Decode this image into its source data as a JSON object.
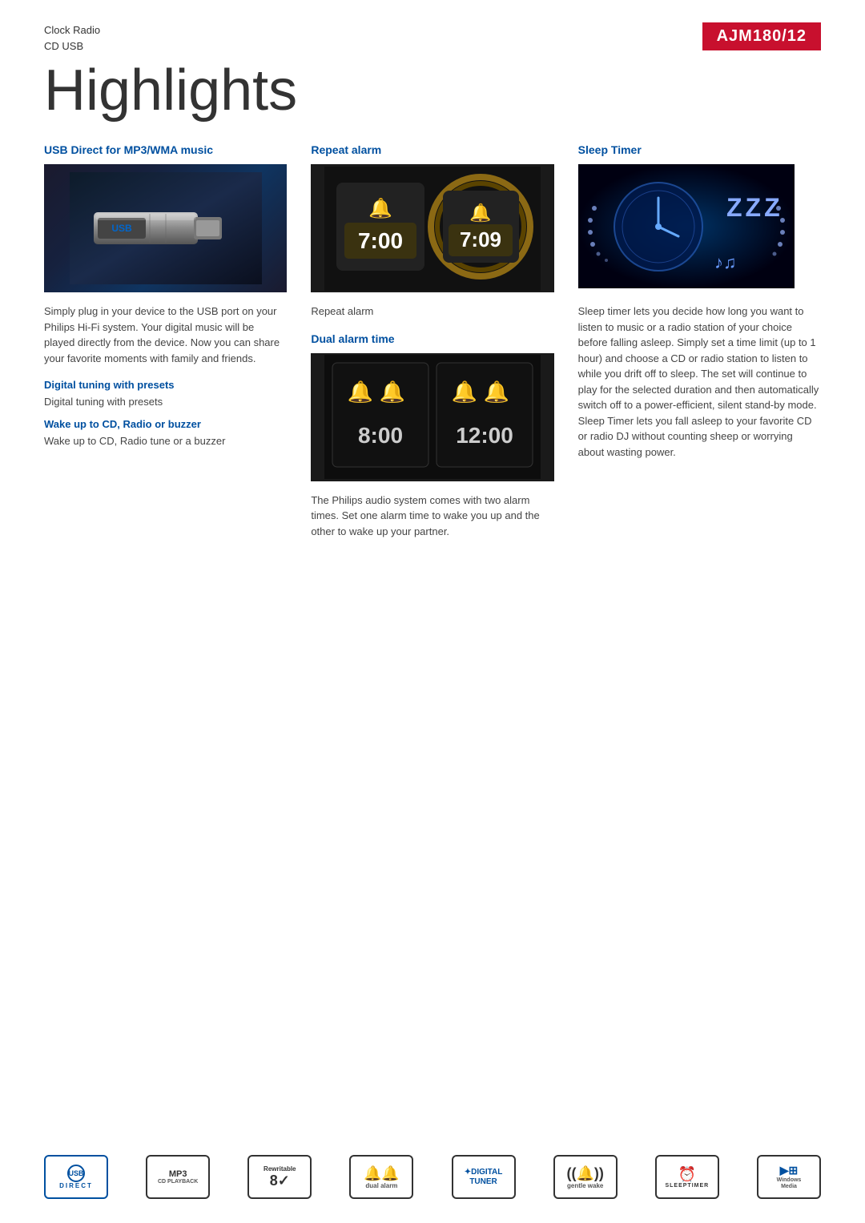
{
  "header": {
    "product_type": "Clock Radio",
    "product_subtype": "CD USB",
    "model": "AJM180/12"
  },
  "page": {
    "title": "Highlights"
  },
  "columns": [
    {
      "id": "col1",
      "sections": [
        {
          "id": "usb-direct",
          "title": "USB Direct for MP3/WMA music",
          "description": "Simply plug in your device to the USB port on your Philips Hi-Fi system. Your digital music will be played directly from the device. Now you can share your favorite moments with family and friends.",
          "image_alt": "USB drive image"
        },
        {
          "id": "digital-tuning",
          "title": "Digital tuning with presets",
          "description": "Digital tuning with presets"
        },
        {
          "id": "wake-up",
          "title": "Wake up to CD, Radio or buzzer",
          "description": "Wake up to CD, Radio tune or a buzzer"
        }
      ]
    },
    {
      "id": "col2",
      "sections": [
        {
          "id": "repeat-alarm",
          "title": "Repeat alarm",
          "image_alt": "Repeat alarm clock display",
          "description": "Repeat alarm",
          "time1": "7:00",
          "time2": "7:09"
        },
        {
          "id": "dual-alarm",
          "title": "Dual alarm time",
          "image_alt": "Dual alarm clock display",
          "description": "The Philips audio system comes with two alarm times. Set one alarm time to wake you up and the other to wake up your partner.",
          "time1": "8:00",
          "time2": "12:00"
        }
      ]
    },
    {
      "id": "col3",
      "sections": [
        {
          "id": "sleep-timer",
          "title": "Sleep Timer",
          "image_alt": "Sleep timer clock image",
          "description": "Sleep timer lets you decide how long you want to listen to music or a radio station of your choice before falling asleep. Simply set a time limit (up to 1 hour) and choose a CD or radio station to listen to while you drift off to sleep. The set will continue to play for the selected duration and then automatically switch off to a power-efficient, silent stand-by mode. Sleep Timer lets you fall asleep to your favorite CD or radio DJ without counting sheep or worrying about wasting power."
        }
      ]
    }
  ],
  "footer": {
    "badges": [
      {
        "id": "usb-direct-badge",
        "icon": "USB",
        "label": "DIRECT",
        "type": "usb"
      },
      {
        "id": "mp3-badge",
        "icon": "MP3",
        "label": "CD PLAYBACK",
        "type": "mp3"
      },
      {
        "id": "rewritable-badge",
        "icon": "8✓",
        "label": "Rewritable",
        "type": "rewritable"
      },
      {
        "id": "dual-alarm-badge",
        "icon": "🔔🔔",
        "label": "dual alarm",
        "type": "dual"
      },
      {
        "id": "digital-tuner-badge",
        "icon": "DIGITAL\nTUNER",
        "label": "",
        "type": "digital"
      },
      {
        "id": "gentle-wake-badge",
        "icon": "((🔔))",
        "label": "gentle wake",
        "type": "gentle"
      },
      {
        "id": "sleep-timer-badge",
        "icon": "⏰:",
        "label": "SLEEPTIMER",
        "type": "sleep"
      },
      {
        "id": "windows-media-badge",
        "icon": "▶",
        "label": "Windows\nMedia",
        "type": "windows"
      }
    ]
  }
}
